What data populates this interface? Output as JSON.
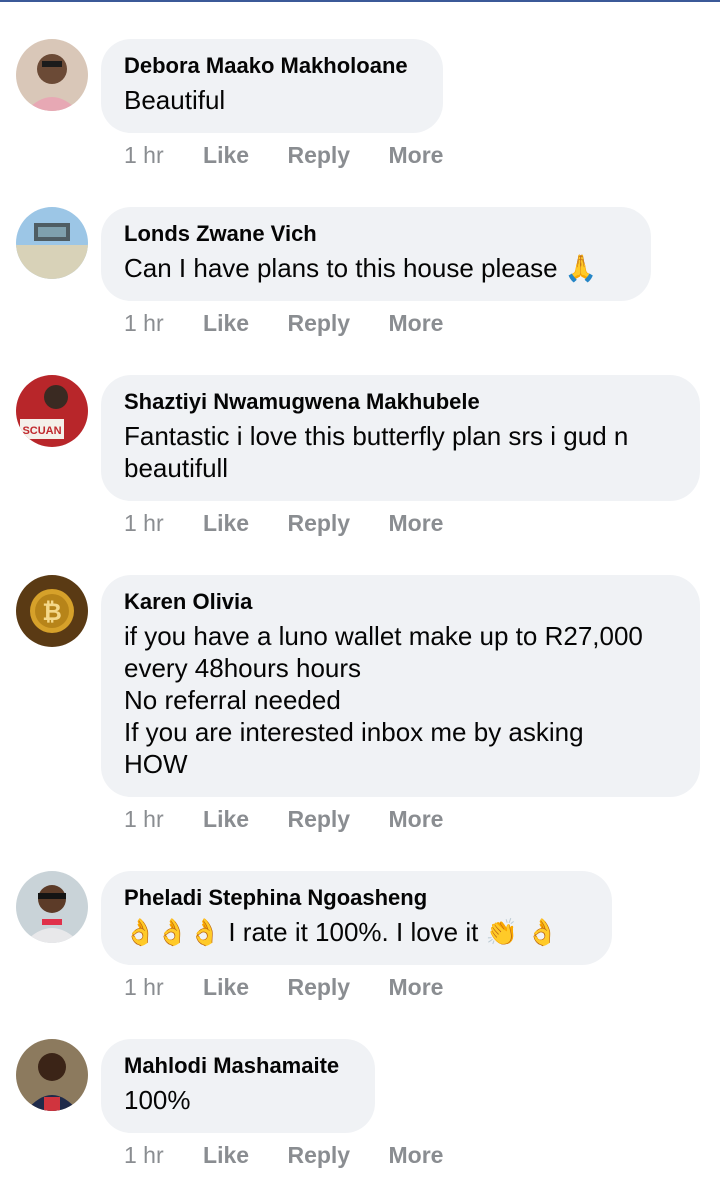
{
  "comments": [
    {
      "author": "Debora Maako Makholoane",
      "lines": [
        "Beautiful"
      ],
      "time": "1 hr",
      "actions": {
        "like": "Like",
        "reply": "Reply",
        "more": "More"
      }
    },
    {
      "author": "Londs Zwane Vich",
      "lines": [
        "Can I have plans to this house please"
      ],
      "trailing_emoji": "🙏",
      "time": "1 hr",
      "actions": {
        "like": "Like",
        "reply": "Reply",
        "more": "More"
      }
    },
    {
      "author": "Shaztiyi Nwamugwena Makhubele",
      "lines": [
        "Fantastic i love this butterfly plan srs i gud n",
        "beautifull"
      ],
      "avatar_text": "SCUAN",
      "time": "1 hr",
      "actions": {
        "like": "Like",
        "reply": "Reply",
        "more": "More"
      }
    },
    {
      "author": "Karen Olivia",
      "lines": [
        "if you have a luno wallet make up to R27,000",
        "every 48hours hours",
        "No referral needed",
        "If you are interested inbox me by asking",
        "HOW"
      ],
      "time": "1 hr",
      "actions": {
        "like": "Like",
        "reply": "Reply",
        "more": "More"
      }
    },
    {
      "author": "Pheladi Stephina Ngoasheng",
      "lead_emoji": "👌👌👌",
      "lines": [
        " I rate it 100%. I love it "
      ],
      "trailing_emoji": "👏 👌",
      "time": "1 hr",
      "actions": {
        "like": "Like",
        "reply": "Reply",
        "more": "More"
      }
    },
    {
      "author": "Mahlodi Mashamaite",
      "lines": [
        "100%"
      ],
      "time": "1 hr",
      "actions": {
        "like": "Like",
        "reply": "Reply",
        "more": "More"
      }
    }
  ],
  "colors": {
    "bubble": "#f0f2f5",
    "text": "#050505",
    "meta": "#8a8d91",
    "topbar": "#3b5998"
  }
}
